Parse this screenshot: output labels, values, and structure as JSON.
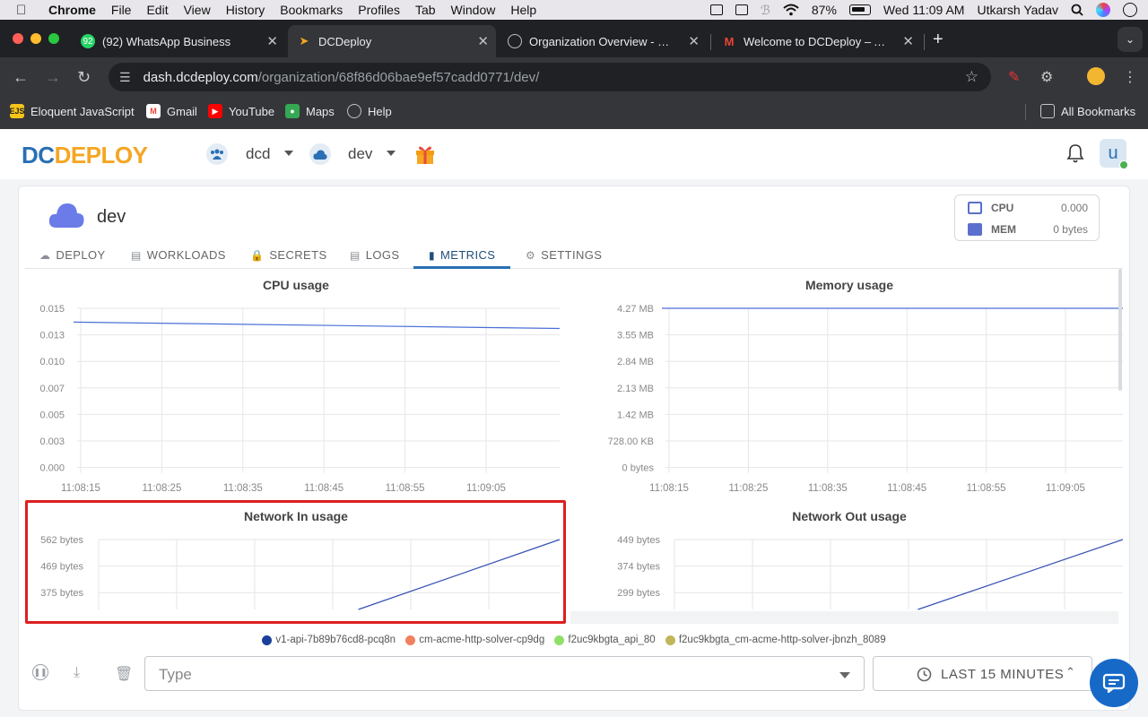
{
  "menubar": {
    "app": "Chrome",
    "items": [
      "File",
      "Edit",
      "View",
      "History",
      "Bookmarks",
      "Profiles",
      "Tab",
      "Window",
      "Help"
    ],
    "battery": "87%",
    "datetime": "Wed 11:09 AM",
    "user": "Utkarsh Yadav"
  },
  "browser": {
    "tabs": [
      {
        "title": "(92) WhatsApp Business",
        "icon": "whatsapp-icon",
        "badge": "92",
        "active": false
      },
      {
        "title": "DCDeploy",
        "icon": "dcdeploy-icon",
        "active": true
      },
      {
        "title": "Organization Overview - DCD",
        "icon": "globe-icon",
        "active": false
      },
      {
        "title": "Welcome to DCDeploy – Activ",
        "icon": "gmail-icon",
        "active": false
      }
    ],
    "url_host": "dash.dcdeploy.com",
    "url_path": "/organization/68f86d06bae9ef57cadd0771/dev/",
    "bookmarks": [
      {
        "label": "Eloquent JavaScript",
        "icon": "ejs-icon"
      },
      {
        "label": "Gmail",
        "icon": "gmail-icon"
      },
      {
        "label": "YouTube",
        "icon": "youtube-icon"
      },
      {
        "label": "Maps",
        "icon": "maps-icon"
      },
      {
        "label": "Help",
        "icon": "globe-icon"
      }
    ],
    "all_bookmarks": "All Bookmarks"
  },
  "app": {
    "logo_dc": "DC",
    "logo_deploy": "DEPLOY",
    "org": "dcd",
    "env": "dev",
    "avatar": "u"
  },
  "env": {
    "title": "dev",
    "cpu_label": "CPU",
    "cpu_value": "0.000",
    "mem_label": "MEM",
    "mem_value": "0 bytes"
  },
  "tabs": [
    {
      "label": "DEPLOY",
      "icon": "cloud-upload-icon"
    },
    {
      "label": "WORKLOADS",
      "icon": "server-icon"
    },
    {
      "label": "SECRETS",
      "icon": "lock-icon"
    },
    {
      "label": "LOGS",
      "icon": "document-icon"
    },
    {
      "label": "METRICS",
      "icon": "bar-chart-icon",
      "active": true
    },
    {
      "label": "SETTINGS",
      "icon": "gear-icon"
    }
  ],
  "chart_data": [
    {
      "type": "line",
      "title": "CPU usage",
      "x_ticks": [
        "11:08:15",
        "11:08:25",
        "11:08:35",
        "11:08:45",
        "11:08:55",
        "11:09:05"
      ],
      "y_ticks": [
        "0.015",
        "0.013",
        "0.010",
        "0.007",
        "0.005",
        "0.003",
        "0.000"
      ],
      "ylim": [
        0,
        0.015
      ],
      "series": [
        {
          "color": "#4a6fd8",
          "points": [
            [
              0,
              0.0137
            ],
            [
              6,
              0.0131
            ]
          ]
        }
      ]
    },
    {
      "type": "line",
      "title": "Memory usage",
      "x_ticks": [
        "11:08:15",
        "11:08:25",
        "11:08:35",
        "11:08:45",
        "11:08:55",
        "11:09:05"
      ],
      "y_ticks": [
        "4.27 MB",
        "3.55 MB",
        "2.84 MB",
        "2.13 MB",
        "1.42 MB",
        "728.00 KB",
        "0 bytes"
      ],
      "ylim": [
        0,
        4.27
      ],
      "series": [
        {
          "color": "#4a6fd8",
          "points": [
            [
              0,
              4.27
            ],
            [
              6,
              4.27
            ]
          ]
        }
      ]
    },
    {
      "type": "line",
      "title": "Network In usage",
      "y_ticks": [
        "562 bytes",
        "469 bytes",
        "375 bytes"
      ],
      "series": [
        {
          "color": "#3550b5",
          "points": [
            [
              3.2,
              300
            ],
            [
              6,
              562
            ]
          ]
        }
      ]
    },
    {
      "type": "line",
      "title": "Network Out usage",
      "y_ticks": [
        "449 bytes",
        "374 bytes",
        "299 bytes"
      ],
      "series": [
        {
          "color": "#3550b5",
          "points": [
            [
              3.1,
              240
            ],
            [
              6,
              449
            ]
          ]
        }
      ]
    }
  ],
  "legend": [
    {
      "label": "v1-api-7b89b76cd8-pcq8n",
      "color": "#1a3f9c"
    },
    {
      "label": "cm-acme-http-solver-cp9dg",
      "color": "#f08060"
    },
    {
      "label": "f2uc9kbgta_api_80",
      "color": "#8ee06a"
    },
    {
      "label": "f2uc9kbgta_cm-acme-http-solver-jbnzh_8089",
      "color": "#c2b65a"
    }
  ],
  "controls": {
    "type_placeholder": "Type",
    "range_label": "LAST 15 MINUTES"
  }
}
